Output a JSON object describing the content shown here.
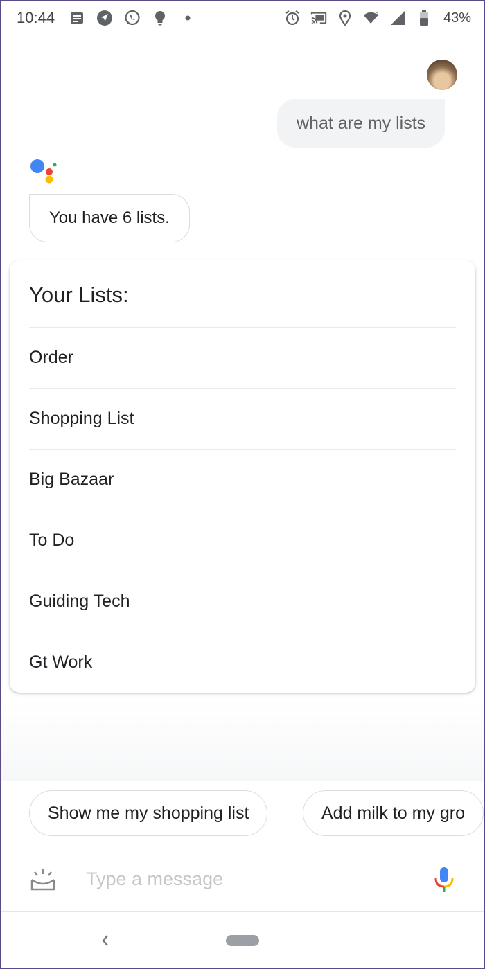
{
  "status_bar": {
    "time": "10:44",
    "battery": "43%",
    "left_icons": [
      "notes-icon",
      "navigation-icon",
      "whatsapp-icon",
      "bulb-icon",
      "dot-icon"
    ],
    "right_icons": [
      "alarm-icon",
      "cast-icon",
      "location-icon",
      "wifi-icon",
      "signal-icon",
      "battery-icon"
    ]
  },
  "conversation": {
    "user_query": "what are my lists",
    "assistant_reply": "You have 6 lists."
  },
  "lists_card": {
    "title": "Your Lists:",
    "items": [
      "Order",
      "Shopping List",
      "Big Bazaar",
      "To Do",
      "Guiding Tech",
      "Gt Work"
    ]
  },
  "suggestions": [
    "Show me my shopping list",
    "Add milk to my gro"
  ],
  "input": {
    "placeholder": "Type a message"
  },
  "colors": {
    "google_blue": "#4285F4",
    "google_red": "#EA4335",
    "google_yellow": "#FBBC05",
    "google_green": "#34A853"
  }
}
